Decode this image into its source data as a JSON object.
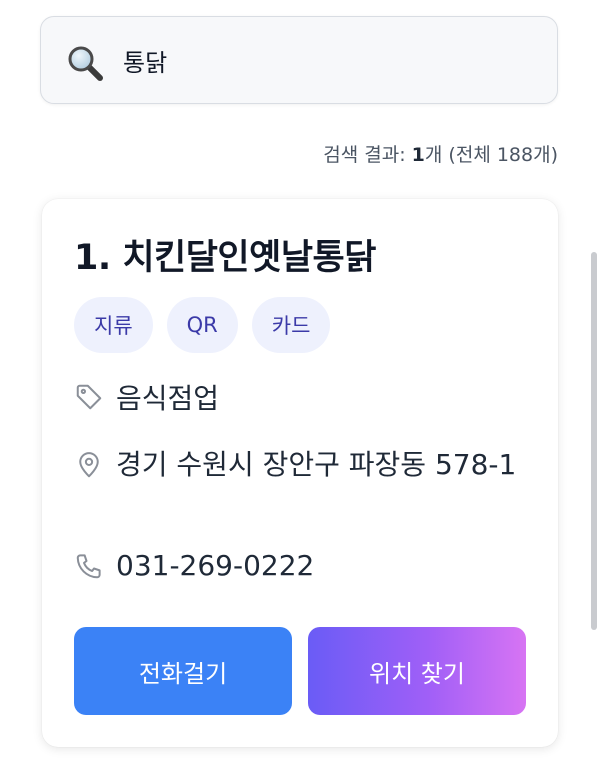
{
  "search": {
    "query": "통닭",
    "icon": "search-icon"
  },
  "result_summary": {
    "prefix": "검색 결과: ",
    "count": "1",
    "suffix": "개 (전체 188개)"
  },
  "card": {
    "title": "1. 치킨달인옛날통닭",
    "tags": [
      "지류",
      "QR",
      "카드"
    ],
    "category": "음식점업",
    "address": "경기 수원시 장안구 파장동 578-1",
    "phone": "031-269-0222",
    "call_label": "전화걸기",
    "location_label": "위치 찾기"
  },
  "colors": {
    "tag_bg": "#eef1fd",
    "tag_text": "#3b3aa8",
    "call_button": "#3b82f6",
    "location_gradient_start": "#6a5cf6",
    "location_gradient_end": "#d774f3"
  }
}
